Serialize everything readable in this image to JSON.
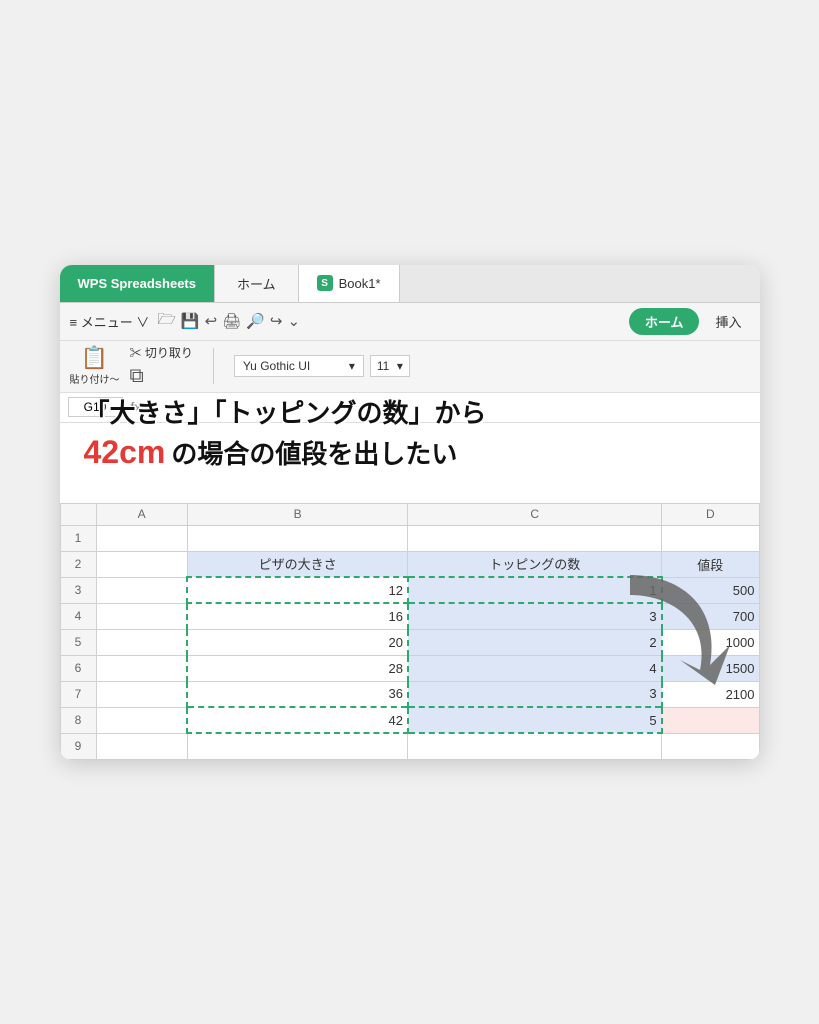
{
  "tabs": {
    "wps": "WPS Spreadsheets",
    "home": "ホーム",
    "book_icon": "S",
    "book": "Book1*"
  },
  "toolbar": {
    "menu": "≡ メニュー ∨",
    "home_btn": "ホーム",
    "insert_btn": "挿入"
  },
  "ribbon": {
    "paste_label": "貼り付け～",
    "cut_label": "✂ 切り取り",
    "font_name": "Yu Gothic UI",
    "font_size": "11"
  },
  "formula_bar": {
    "cell_ref": "G10",
    "fx": "fx"
  },
  "annotation": {
    "line1": "「大きさ」「トッピングの数」から",
    "cm_label": "42cm",
    "line2_rest": "の場合の値段を出したい"
  },
  "sheet": {
    "col_headers": [
      "",
      "A",
      "B",
      "C",
      "D"
    ],
    "headers_row": [
      "ピザの大きさ",
      "トッピングの数",
      "値段"
    ],
    "rows": [
      {
        "num": "1",
        "a": "",
        "b": "",
        "c": "",
        "d": ""
      },
      {
        "num": "2",
        "a": "",
        "b": "ピザの大きさ",
        "c": "トッピングの数",
        "d": "値段"
      },
      {
        "num": "3",
        "a": "",
        "b": "12",
        "c": "1",
        "d": "500"
      },
      {
        "num": "4",
        "a": "",
        "b": "16",
        "c": "3",
        "d": "700"
      },
      {
        "num": "5",
        "a": "",
        "b": "20",
        "c": "2",
        "d": "1000"
      },
      {
        "num": "6",
        "a": "",
        "b": "28",
        "c": "4",
        "d": "1500"
      },
      {
        "num": "7",
        "a": "",
        "b": "36",
        "c": "3",
        "d": "2100"
      },
      {
        "num": "8",
        "a": "",
        "b": "42",
        "c": "5",
        "d": ""
      },
      {
        "num": "9",
        "a": "",
        "b": "",
        "c": "",
        "d": ""
      }
    ]
  }
}
